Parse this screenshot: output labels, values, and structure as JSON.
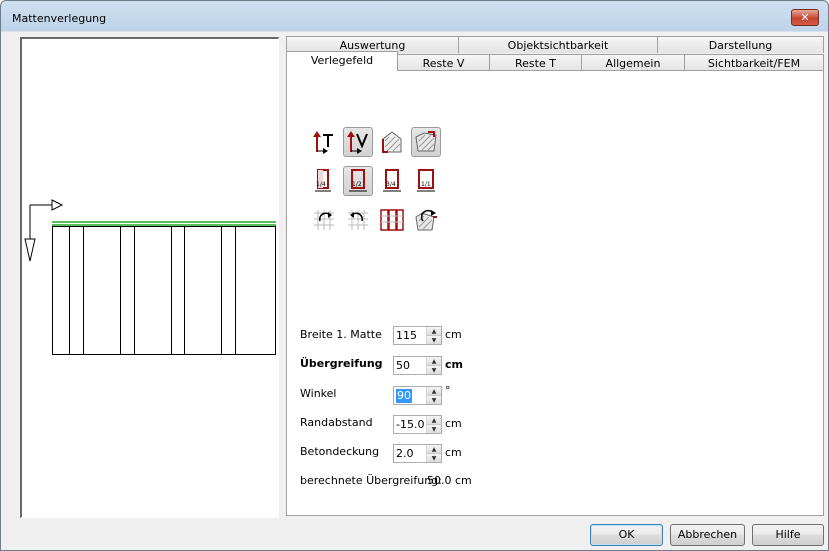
{
  "window": {
    "title": "Mattenverlegung",
    "close_label": "✕"
  },
  "tabs": {
    "row_back": [
      "Auswertung",
      "Objektsichtbarkeit",
      "Darstellung"
    ],
    "row_front": [
      "Verlegefeld",
      "Reste V",
      "Reste T",
      "Allgemein",
      "Sichtbarkeit/FEM"
    ],
    "active": "Verlegefeld"
  },
  "toolbar_icons": [
    [
      "direction-t-icon",
      "direction-v-icon",
      "field-polygon-icon",
      "field-area-icon"
    ],
    [
      "quarter-mat-icon",
      "half-mat-icon",
      "three-quarter-mat-icon",
      "full-mat-icon"
    ],
    [
      "rotate-mat-left-icon",
      "rotate-mat-right-icon",
      "mat-grid-icon",
      "rotate-field-icon"
    ]
  ],
  "form": {
    "breite": {
      "label": "Breite 1. Matte",
      "value": "115",
      "unit": "cm"
    },
    "uebergreifung": {
      "label": "Übergreifung",
      "value": "50",
      "unit": "cm"
    },
    "winkel": {
      "label": "Winkel",
      "value": "90",
      "unit": "°"
    },
    "randabstand": {
      "label": "Randabstand",
      "value": "-15.0",
      "unit": "cm"
    },
    "betondeckung": {
      "label": "Betondeckung",
      "value": "2.0",
      "unit": "cm"
    },
    "calc_label": "berechnete Übergreifung:",
    "calc_value": "50.0 cm"
  },
  "buttons": {
    "ok": "OK",
    "cancel": "Abbrechen",
    "help": "Hilfe"
  },
  "colors": {
    "accent_red": "#a01010",
    "mat_green": "#22aa22",
    "selection": "#3399ff"
  }
}
